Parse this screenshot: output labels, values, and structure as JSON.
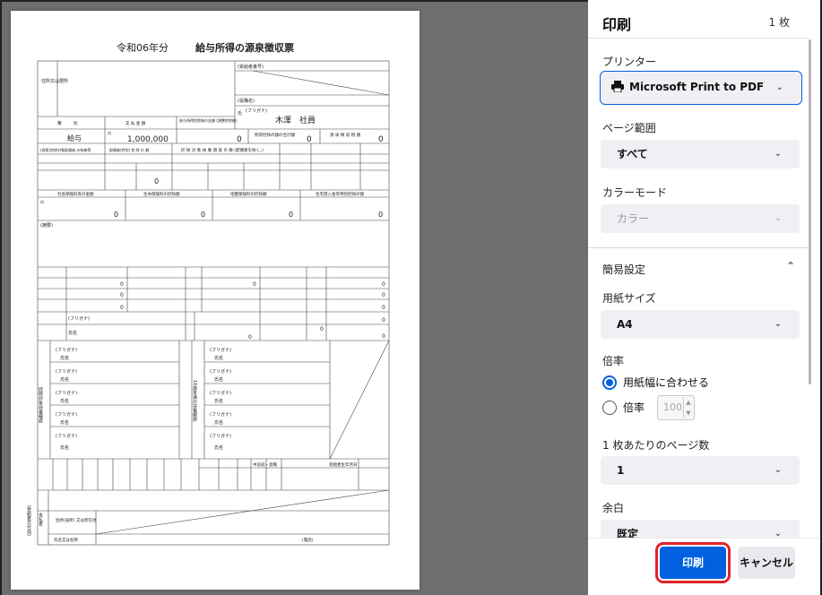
{
  "document": {
    "title_year": "令和06年分",
    "title_main": "給与所得の源泉徴収票",
    "recipient_number_label": "(受給者番号)",
    "role_label": "(役職名)",
    "furigana_label": "(フリガナ)",
    "name_label": "氏",
    "name_value": "木澤　社員",
    "address_label": "住所又は居所",
    "col_type": "種　　　別",
    "col_payment": "支 払 金 額",
    "col_deduct": "給与所得控除後の金額 (調整控除後)",
    "col_total_deduct": "所得控除の額の合計額",
    "col_tax": "源 泉 徴 収 税 額",
    "type_value": "給与",
    "payment_value": "1,000,000",
    "deduct_value": "0",
    "total_deduct_value": "0",
    "tax_value": "0",
    "yen": "円",
    "inner": "内",
    "dependents_header": "控 除 対 象 扶 養 親 族 の 数 (配偶者を除く。)",
    "spouse_label": "(源泉)控除対象配偶者 の有無等",
    "spouse_special": "配偶者(特別) 控 除 の 額",
    "row_zero": "0",
    "insurance_social": "社会保険料等の金額",
    "insurance_life": "生命保険料の控除額",
    "insurance_quake": "地震保険料の控除額",
    "housing_loan": "住宅借入金等特別控除の額",
    "summary_label": "(摘要)",
    "spouse_name_kana": "(フリガナ)",
    "name_short": "氏名",
    "dependent_section": "控除対象扶養親族",
    "under16_section": "16歳未満の扶養親族",
    "payer_address": "住所(居所) 又は所在地",
    "payer_name": "氏名又は名称",
    "payer_phone": "(電話)",
    "side_label": "(受給者交付用)",
    "payer_section": "支払者",
    "year_header": "中途就・退職",
    "birth_header": "受給者生年月日"
  },
  "panel": {
    "title": "印刷",
    "pages_count": "1 枚",
    "printer_label": "プリンター",
    "printer_value": "Microsoft Print to PDF",
    "page_range_label": "ページ範囲",
    "page_range_value": "すべて",
    "color_mode_label": "カラーモード",
    "color_mode_value": "カラー",
    "simple_settings_label": "簡易設定",
    "paper_size_label": "用紙サイズ",
    "paper_size_value": "A4",
    "scale_label": "倍率",
    "fit_width_label": "用紙幅に合わせる",
    "scale_option_label": "倍率",
    "scale_value": "100",
    "pages_per_sheet_label": "1 枚あたりのページ数",
    "pages_per_sheet_value": "1",
    "margin_label": "余白",
    "margin_value": "既定",
    "print_button": "印刷",
    "cancel_button": "キャンセル"
  },
  "colors": {
    "accent": "#0060df",
    "highlight": "#e0232b",
    "preview_bg": "#6e6e6e"
  }
}
